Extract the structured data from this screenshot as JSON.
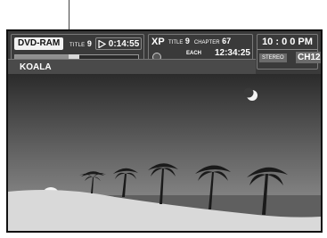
{
  "osd": {
    "format": "DVD-RAM",
    "title_prefix": "TITLE",
    "title_number": "9",
    "elapsed_time": "0:14:55",
    "progress_fraction": 0.48,
    "program_name": "KOALA",
    "recording_mode": "XP",
    "mid_title_prefix": "TITLE",
    "mid_title_number": "9",
    "chapter_prefix": "CHAPTER",
    "chapter_number": "67",
    "each_label": "EACH",
    "total_time": "12:34:25",
    "clock": "10 : 0 0 PM",
    "audio_mode": "STEREO",
    "channel": "CH12"
  },
  "icons": {
    "play": "play-icon",
    "disc": "disc-icon"
  },
  "colors": {
    "osd_background": "#3a3a3a",
    "badge_background": "#f2f2f2",
    "text": "#ffffff"
  }
}
